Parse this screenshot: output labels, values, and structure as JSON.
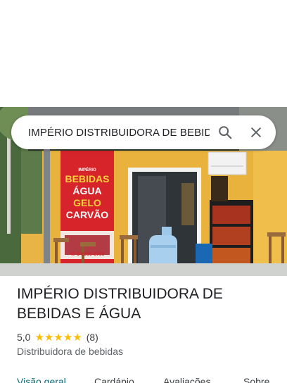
{
  "search": {
    "query": "IMPÉRIO DISTRIBUIDORA DE BEBIDAS E ÁGUA"
  },
  "hero_sign": {
    "brand": "IMPÉRIO",
    "line1": "BEBIDAS",
    "line2": "ÁGUA",
    "line3": "GELO",
    "line4": "CARVÃO",
    "phone": "47 9 9956-8788"
  },
  "place": {
    "name": "IMPÉRIO DISTRIBUIDORA DE BEBIDAS E ÁGUA",
    "rating": "5,0",
    "stars": 5,
    "review_count": "(8)",
    "category": "Distribuidora de bebidas"
  },
  "tabs": [
    {
      "label": "Visão geral",
      "active": true
    },
    {
      "label": "Cardápio",
      "active": false
    },
    {
      "label": "Avaliações",
      "active": false
    },
    {
      "label": "Sobre",
      "active": false
    }
  ],
  "colors": {
    "accent_tab": "#0b6e7a",
    "star": "#fbbc04",
    "wall": "#e9b94a"
  },
  "icons": {
    "search": "search-icon",
    "close": "close-icon",
    "star": "star-icon"
  }
}
